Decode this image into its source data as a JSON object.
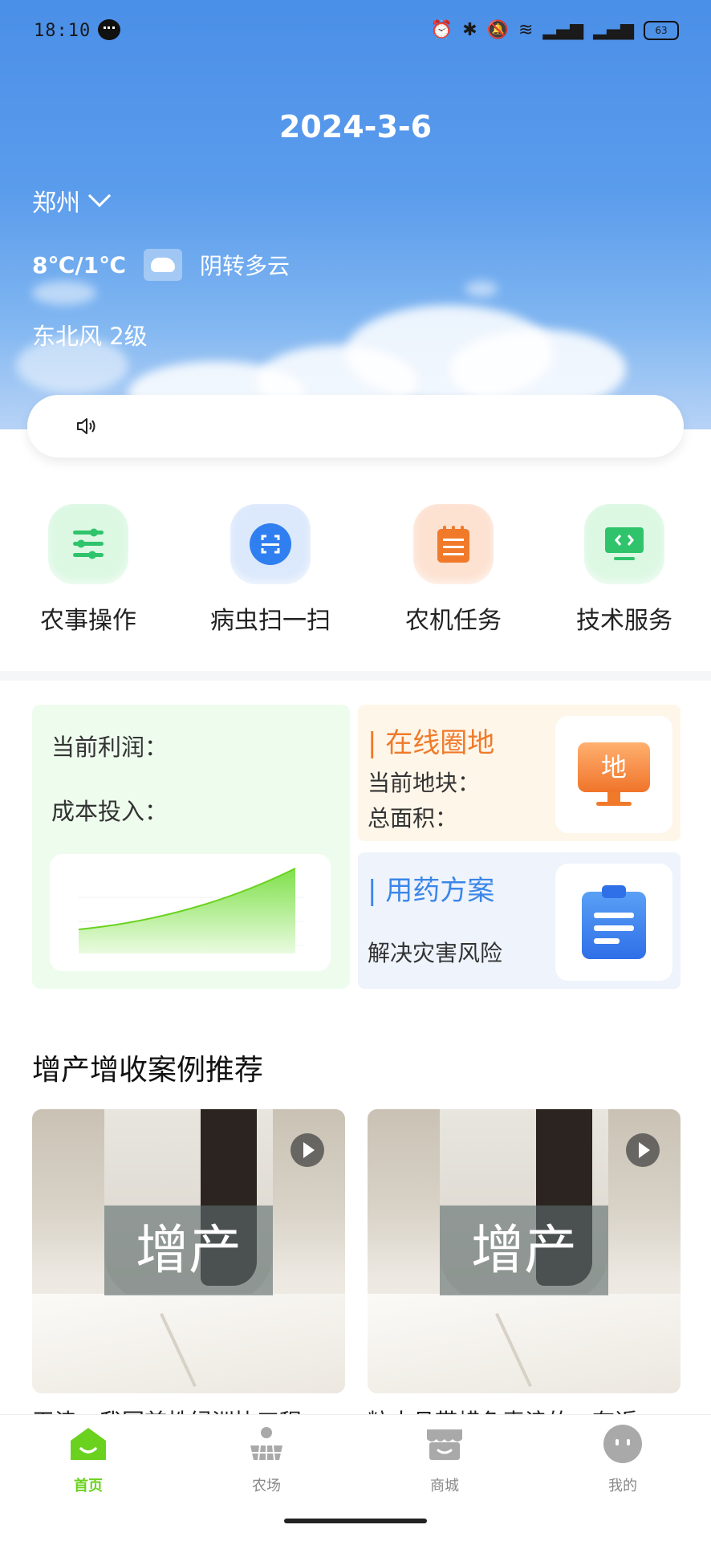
{
  "status_bar": {
    "time": "18:10",
    "battery": "63"
  },
  "weather": {
    "date": "2024-3-6",
    "city": "郑州",
    "temperature": "8℃/1℃",
    "description": "阴转多云",
    "wind": "东北风 2级"
  },
  "quick_actions": [
    {
      "label": "农事操作",
      "icon": "sliders-icon",
      "color": "#2fc46b"
    },
    {
      "label": "病虫扫一扫",
      "icon": "scan-icon",
      "color": "#2f7ff0"
    },
    {
      "label": "农机任务",
      "icon": "notepad-icon",
      "color": "#f07a2a"
    },
    {
      "label": "技术服务",
      "icon": "monitor-code-icon",
      "color": "#2fc46b"
    }
  ],
  "profit_card": {
    "current_profit_label": "当前利润：",
    "cost_input_label": "成本投入：",
    "accent": "#7fe04a"
  },
  "online_circle": {
    "title": "| 在线圈地",
    "plot_label": "当前地块：",
    "area_label": "总面积：",
    "icon_text": "地",
    "accent": "#f07a2a"
  },
  "medicine_plan": {
    "title": "| 用药方案",
    "subtitle": "解决灾害风险",
    "accent": "#3b86e8"
  },
  "cases_section": {
    "title": "增产增收案例推荐",
    "items": [
      {
        "overlay": "增产",
        "caption": "天津：我国首株绿洲协工程"
      },
      {
        "overlay": "增产",
        "caption": "粒大且带蜡色麦浪的，有近"
      }
    ]
  },
  "bottom_nav": {
    "items": [
      {
        "label": "首页",
        "icon": "home-icon",
        "active": true
      },
      {
        "label": "农场",
        "icon": "farm-icon",
        "active": false
      },
      {
        "label": "商城",
        "icon": "shop-icon",
        "active": false
      },
      {
        "label": "我的",
        "icon": "profile-icon",
        "active": false
      }
    ],
    "active_color": "#6ad21f"
  }
}
